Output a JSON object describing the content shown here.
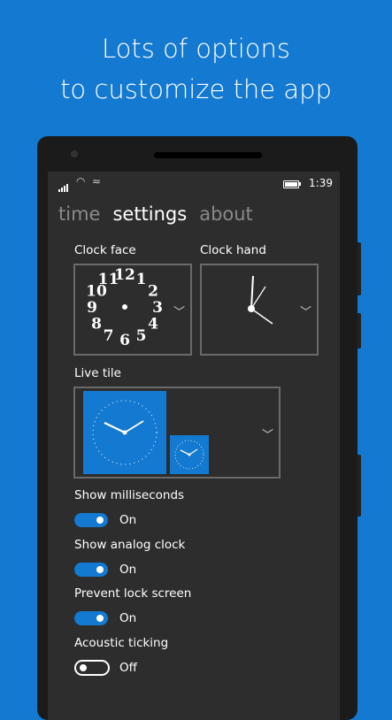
{
  "headline": {
    "line1": "Lots of options",
    "line2": "to customize the app"
  },
  "status_bar": {
    "time": "1:39"
  },
  "pivot": {
    "tabs": [
      "time",
      "settings",
      "about"
    ],
    "active_index": 1
  },
  "settings": {
    "clock_face_label": "Clock face",
    "clock_face_numerals": [
      "12",
      "1",
      "2",
      "3",
      "4",
      "5",
      "6",
      "7",
      "8",
      "9",
      "10",
      "11"
    ],
    "clock_hand_label": "Clock hand",
    "live_tile_label": "Live tile",
    "toggles": [
      {
        "label": "Show milliseconds",
        "state_text": "On",
        "on": true
      },
      {
        "label": "Show analog clock",
        "state_text": "On",
        "on": true
      },
      {
        "label": "Prevent lock screen",
        "state_text": "On",
        "on": true
      },
      {
        "label": "Acoustic ticking",
        "state_text": "Off",
        "on": false
      }
    ]
  },
  "colors": {
    "accent": "#1479d0",
    "screen_bg": "#2d2d2d",
    "inactive_tab": "#8a8a8a"
  }
}
